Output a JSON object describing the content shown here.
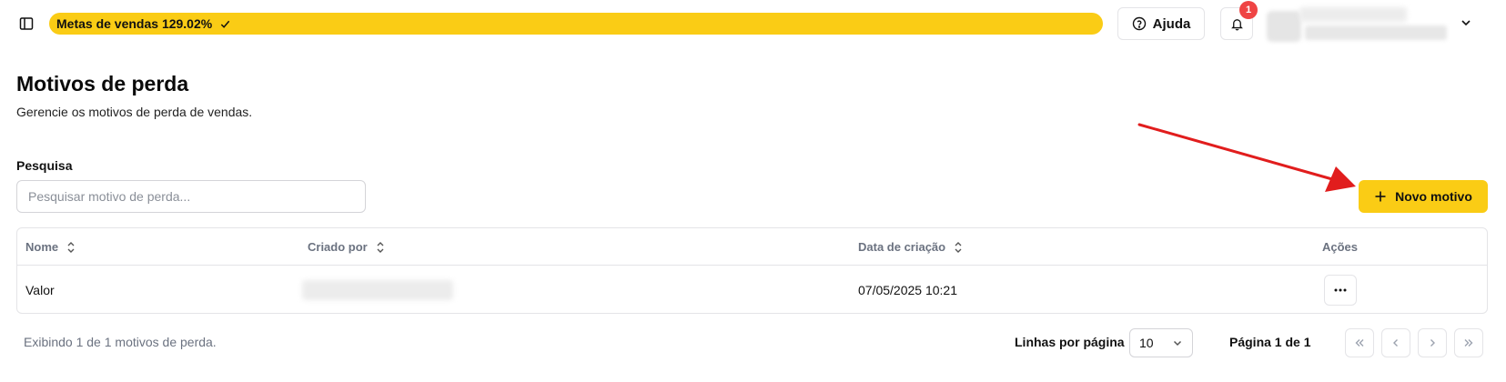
{
  "topbar": {
    "goal_label": "Metas de vendas 129.02%",
    "help_label": "Ajuda",
    "notification_count": "1"
  },
  "page": {
    "title": "Motivos de perda",
    "subtitle": "Gerencie os motivos de perda de vendas."
  },
  "search": {
    "label": "Pesquisa",
    "placeholder": "Pesquisar motivo de perda...",
    "value": ""
  },
  "new_button_label": "Novo motivo",
  "table": {
    "columns": [
      "Nome",
      "Criado por",
      "Data de criação",
      "Ações"
    ],
    "rows": [
      {
        "name": "Valor",
        "created_at": "07/05/2025 10:21"
      }
    ]
  },
  "footer": {
    "count_text": "Exibindo 1 de 1 motivos de perda.",
    "rows_per_page_label": "Linhas por página",
    "rows_per_page_value": "10",
    "page_text": "Página 1 de 1"
  },
  "colors": {
    "accent": "#facc15",
    "badge": "#ef4444",
    "arrow": "#e11d1d"
  }
}
